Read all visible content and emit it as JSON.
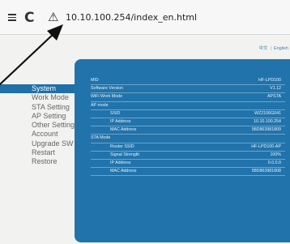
{
  "browser": {
    "url": "10.10.100.254/index_en.html"
  },
  "header": {
    "lang_cn": "中文",
    "lang_sep": "|",
    "lang_en": "English"
  },
  "sidebar": {
    "items": [
      {
        "label": "System"
      },
      {
        "label": "Work Mode"
      },
      {
        "label": "STA Setting"
      },
      {
        "label": "AP Setting"
      },
      {
        "label": "Other Setting"
      },
      {
        "label": "Account"
      },
      {
        "label": "Upgrade SW"
      },
      {
        "label": "Restart"
      },
      {
        "label": "Restore"
      }
    ]
  },
  "info": {
    "rows": [
      {
        "key": "MID",
        "value": "HF-LPD100"
      },
      {
        "key": "Software Version",
        "value": "V1.12"
      },
      {
        "key": "WiFi Work Mode",
        "value": "APSTA"
      },
      {
        "key": "AP mode",
        "value": ""
      },
      {
        "key": "SSID",
        "value": "WZ2106G041"
      },
      {
        "key": "IP Address",
        "value": "10.10.100.254"
      },
      {
        "key": "MAC Address",
        "value": "98D863981809"
      },
      {
        "key": "STA Mode",
        "value": ""
      },
      {
        "key": "Router SSID",
        "value": "HF-LPD100-AP"
      },
      {
        "key": "Signal Strength",
        "value": "100%"
      },
      {
        "key": "IP Address",
        "value": "0.0.0.0"
      },
      {
        "key": "MAC Address",
        "value": "98D863981808"
      }
    ]
  },
  "colors": {
    "accent": "#2173ab",
    "active_item": "#1f6fa8"
  },
  "icons": [
    "menu-icon",
    "reload-icon",
    "warning-icon",
    "arrow-annotation"
  ]
}
